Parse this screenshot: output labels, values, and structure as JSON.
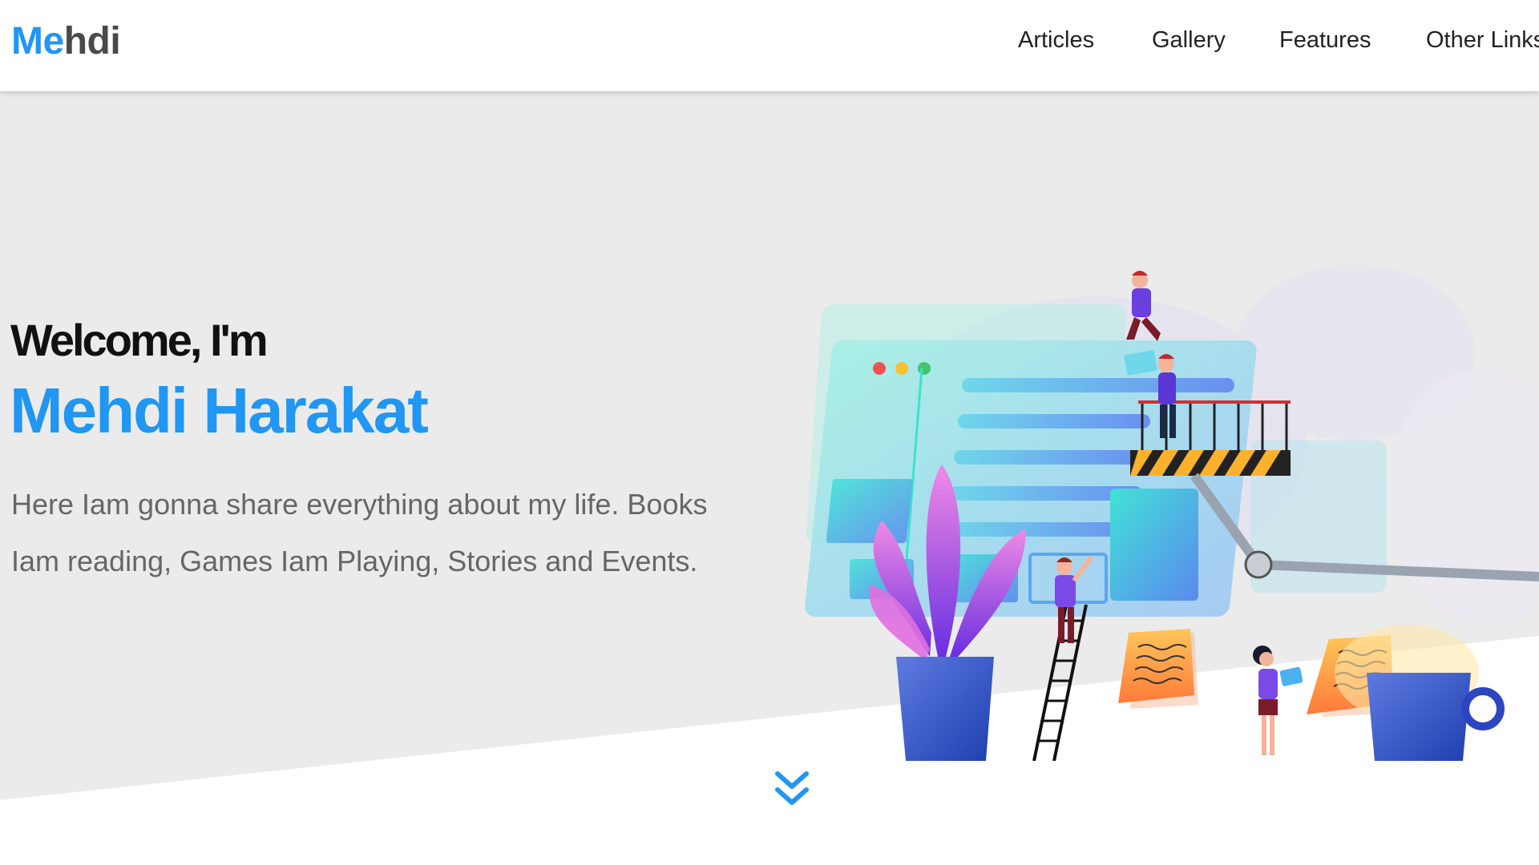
{
  "brand": {
    "logo_part1": "Me",
    "logo_part2": "hdi"
  },
  "nav": {
    "items": [
      "Articles",
      "Gallery",
      "Features",
      "Other Links"
    ]
  },
  "hero": {
    "welcome": "Welcome, I'm",
    "name": "Mehdi Harakat",
    "bio": "Here Iam gonna share everything about my life. Books Iam reading, Games Iam Playing, Stories and Events."
  },
  "icons": {
    "scroll": "chevron-double-down-icon",
    "illustration": "web-builders-illustration"
  },
  "colors": {
    "accent": "#2196f3",
    "logo_dark": "#4a4a4a",
    "hero_bg": "#ebebeb",
    "text_muted": "#666666"
  }
}
